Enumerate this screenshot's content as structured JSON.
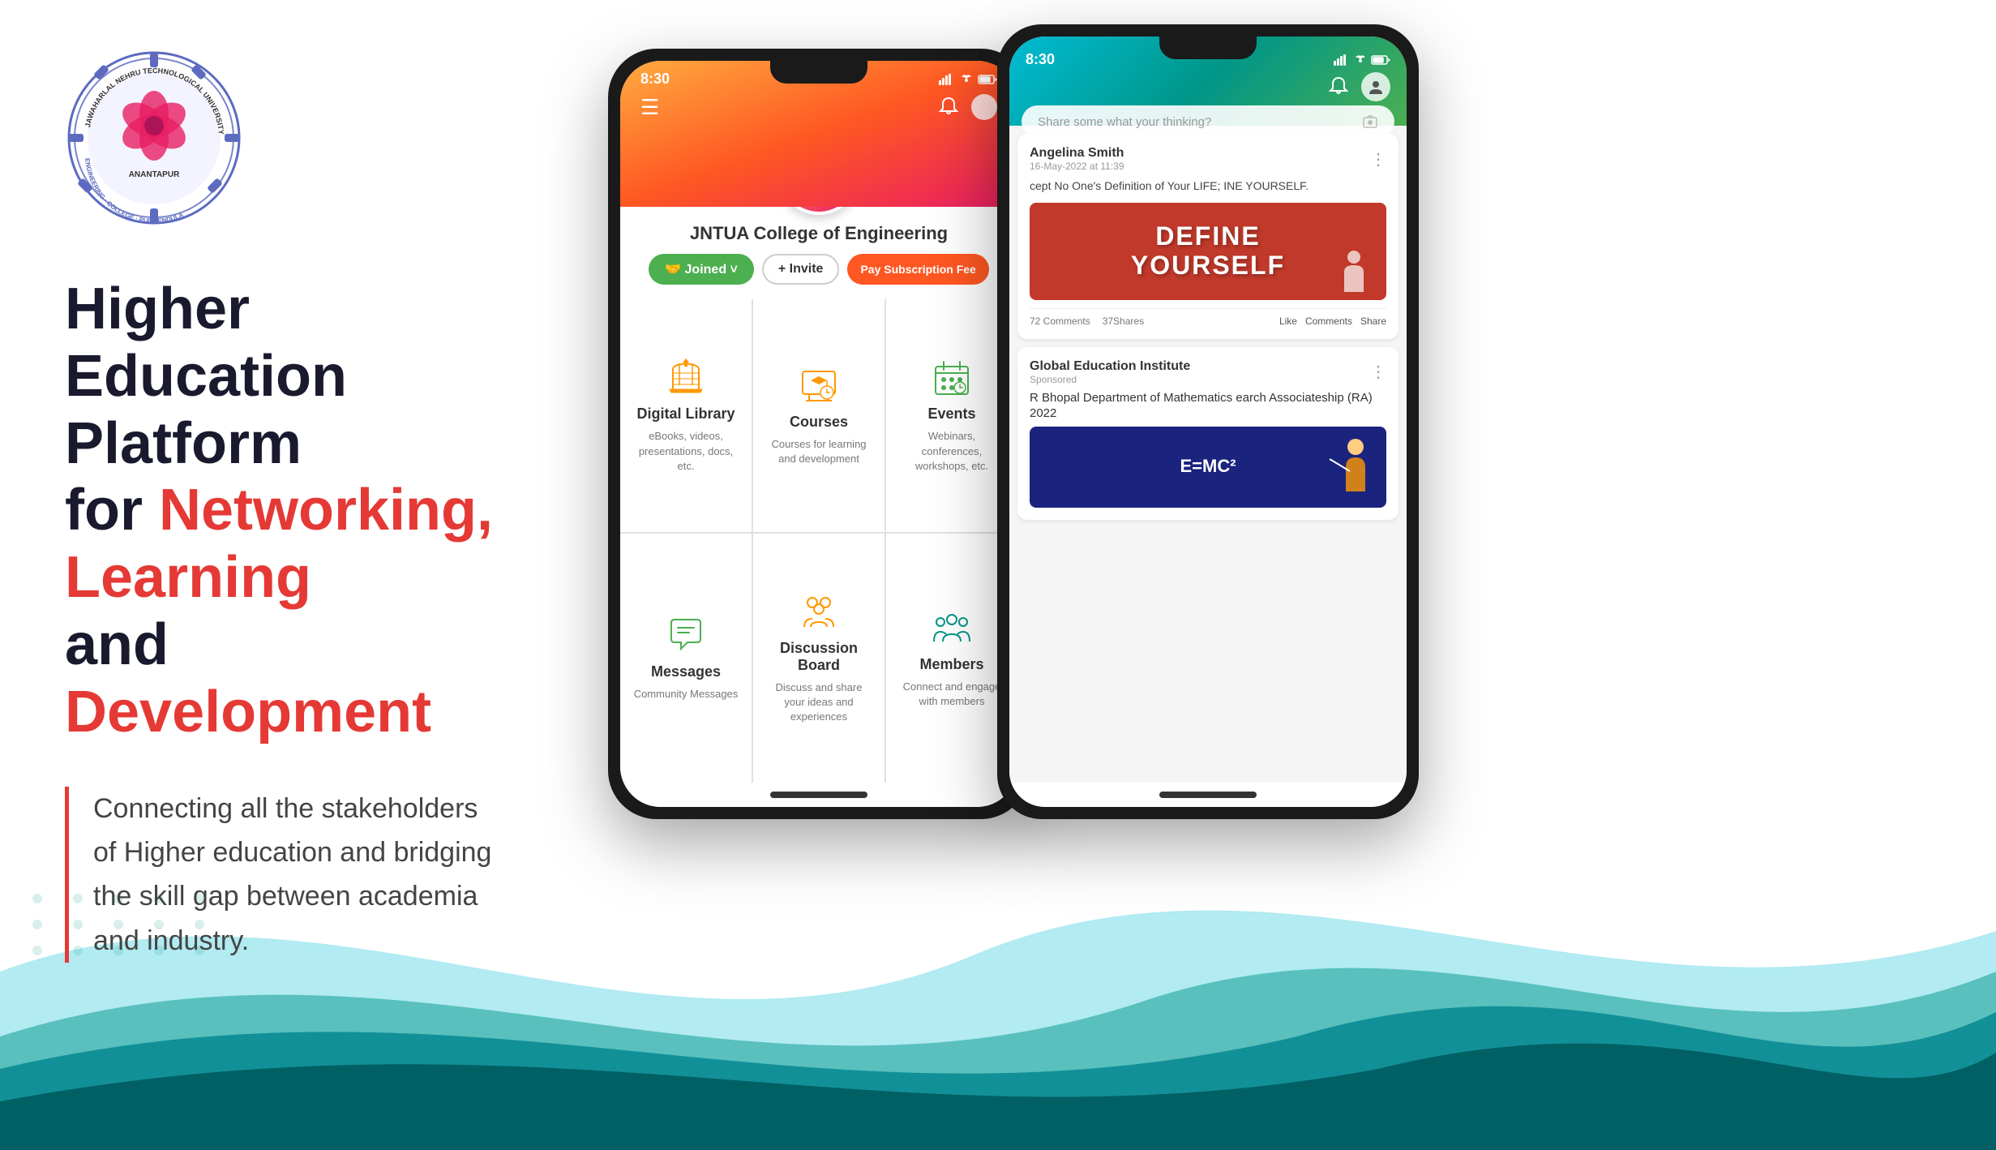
{
  "logo": {
    "alt": "JNTUA Logo",
    "college_text": "COLLEGE"
  },
  "hero": {
    "headline_line1": "Higher Education Platform",
    "headline_line2_prefix": "for ",
    "headline_line2_highlight": "Networking, Learning",
    "headline_line3_prefix": "and ",
    "headline_line3_highlight": "Development",
    "description": "Connecting all the stakeholders of Higher education and bridging the skill gap between academia and industry."
  },
  "phone1": {
    "status_time": "8:30",
    "college_name": "JNTUA College of Engineering",
    "btn_joined": "🤝 Joined ˅",
    "btn_invite": "+ Invite",
    "btn_subscribe": "Pay Subscription Fee",
    "features": [
      {
        "id": "digital-library",
        "title": "Digital Library",
        "desc": "eBooks, videos, presentations, docs, etc.",
        "icon": "📚",
        "color": "orange"
      },
      {
        "id": "courses",
        "title": "Courses",
        "desc": "Courses for learning and development",
        "icon": "🎓",
        "color": "orange"
      },
      {
        "id": "events",
        "title": "Events",
        "desc": "Webinars, conferences, workshops, etc.",
        "icon": "📅",
        "color": "green"
      },
      {
        "id": "messages",
        "title": "Messages",
        "desc": "Community Messages",
        "icon": "💬",
        "color": "green"
      },
      {
        "id": "discussion-board",
        "title": "Discussion Board",
        "desc": "Discuss and share your ideas and experiences",
        "icon": "👥",
        "color": "orange"
      },
      {
        "id": "members",
        "title": "Members",
        "desc": "Connect and engage with members",
        "icon": "👤",
        "color": "teal"
      }
    ]
  },
  "phone2": {
    "status_time": "8:30",
    "search_placeholder": "Share some what your thinking?",
    "post1": {
      "user": "Angelina Smith",
      "time": "16-May-2022 at 11:39",
      "text": "cept No One's Definition of Your LIFE; INE YOURSELF.",
      "image_line1": "DEFINE",
      "image_line2": "YOURSELF",
      "comments": "72 Comments",
      "shares": "37Shares",
      "btn_like": "Like",
      "btn_comments": "Comments",
      "btn_share": "Share"
    },
    "post2": {
      "user": "Global Education Institute",
      "sponsored": "Sponsored",
      "title": "R Bhopal Department of Mathematics earch Associateship (RA) 2022",
      "image_text": "E=MC²"
    }
  }
}
